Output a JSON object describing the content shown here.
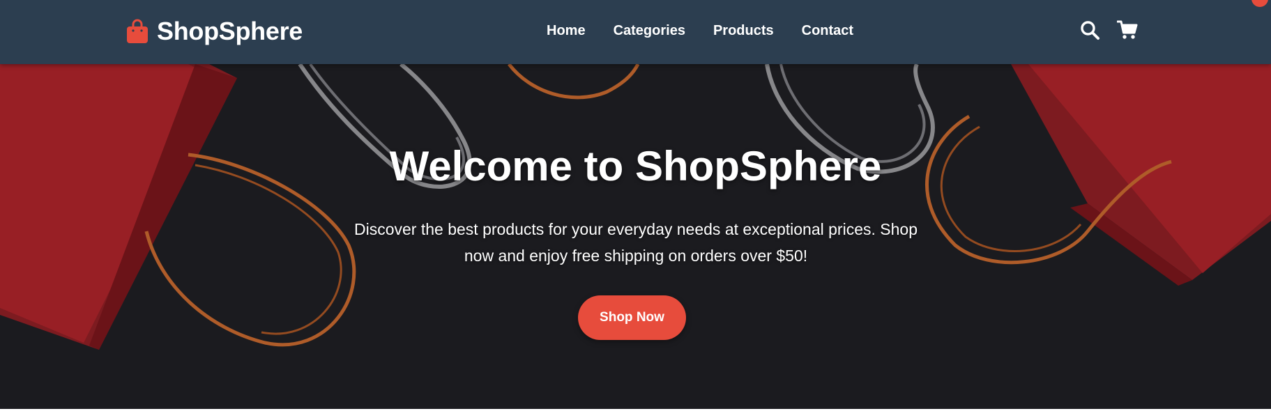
{
  "brand": {
    "name": "ShopSphere",
    "logo_icon": "shopping-bag-icon",
    "accent_color": "#e74c3c",
    "nav_bg_color": "#2c3e50"
  },
  "nav": {
    "links": [
      {
        "label": "Home"
      },
      {
        "label": "Categories"
      },
      {
        "label": "Products"
      },
      {
        "label": "Contact"
      }
    ],
    "icons": [
      "search-icon",
      "cart-icon"
    ]
  },
  "hero": {
    "title": "Welcome to ShopSphere",
    "subtitle": "Discover the best products for your everyday needs at exceptional prices. Shop now and enjoy free shipping on orders over $50!",
    "button_label": "Shop Now",
    "background_description_colors": {
      "background": "#1f1f24",
      "bags": "#b3222a",
      "handles_orange": "#c8692f",
      "handles_white": "#9a9a9e"
    }
  }
}
